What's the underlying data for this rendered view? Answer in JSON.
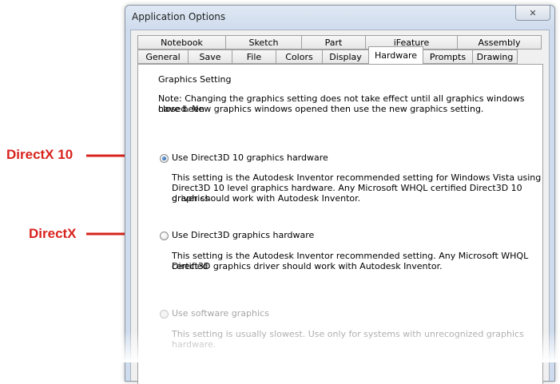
{
  "callouts": {
    "directx10": "DirectX 10",
    "directx": "DirectX",
    "color": "#d8231e"
  },
  "window": {
    "title": "Application Options",
    "close_glyph": "✕"
  },
  "tabs": {
    "row1": [
      "Notebook",
      "Sketch",
      "Part",
      "iFeature",
      "Assembly"
    ],
    "row2": [
      "General",
      "Save",
      "File",
      "Colors",
      "Display",
      "Hardware",
      "Prompts",
      "Drawing"
    ],
    "active": "Hardware"
  },
  "hardware": {
    "group_label": "Graphics Setting",
    "note_line1": "Note: Changing the graphics setting does not take effect until all graphics windows have been",
    "note_line2": "closed.  New graphics windows opened then use the new graphics setting.",
    "options": [
      {
        "label": "Use Direct3D 10 graphics hardware",
        "checked": true,
        "enabled": true,
        "desc": [
          "This setting is the Autodesk Inventor recommended setting for Windows Vista using",
          "Direct3D 10 level graphics hardware.  Any Microsoft WHQL certified Direct3D 10 graphics",
          "driver should work with Autodesk Inventor."
        ]
      },
      {
        "label": "Use Direct3D graphics hardware",
        "checked": false,
        "enabled": true,
        "desc": [
          "This setting is the Autodesk Inventor recommended setting.  Any Microsoft WHQL certified",
          "Direct3D graphics driver should work with Autodesk Inventor."
        ]
      },
      {
        "label": "Use software graphics",
        "checked": false,
        "enabled": false,
        "desc": [
          "This setting is usually slowest.  Use only for systems with unrecognized graphics hardware."
        ]
      }
    ]
  }
}
